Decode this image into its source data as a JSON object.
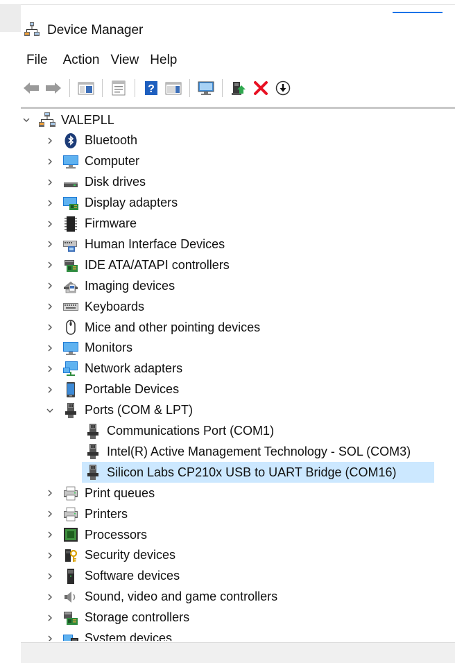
{
  "window": {
    "title": "Device Manager"
  },
  "menu": {
    "items": [
      "File",
      "Action",
      "View",
      "Help"
    ]
  },
  "toolbar": {
    "buttons": [
      {
        "name": "back-icon"
      },
      {
        "name": "forward-icon"
      },
      {
        "name": "show-hide-console-tree-icon"
      },
      {
        "name": "properties-icon"
      },
      {
        "name": "help-icon"
      },
      {
        "name": "action-pane-icon"
      },
      {
        "name": "scan-hardware-icon"
      },
      {
        "name": "update-driver-icon"
      },
      {
        "name": "uninstall-icon"
      },
      {
        "name": "disable-device-icon"
      }
    ]
  },
  "tree": {
    "root": {
      "label": "VALEPLL",
      "expanded": true
    },
    "categories": [
      {
        "label": "Bluetooth",
        "icon": "bluetooth-icon",
        "expanded": false
      },
      {
        "label": "Computer",
        "icon": "computer-icon",
        "expanded": false
      },
      {
        "label": "Disk drives",
        "icon": "disk-drive-icon",
        "expanded": false
      },
      {
        "label": "Display adapters",
        "icon": "display-adapter-icon",
        "expanded": false
      },
      {
        "label": "Firmware",
        "icon": "firmware-icon",
        "expanded": false
      },
      {
        "label": "Human Interface Devices",
        "icon": "hid-icon",
        "expanded": false
      },
      {
        "label": "IDE ATA/ATAPI controllers",
        "icon": "ide-controller-icon",
        "expanded": false
      },
      {
        "label": "Imaging devices",
        "icon": "imaging-icon",
        "expanded": false
      },
      {
        "label": "Keyboards",
        "icon": "keyboard-icon",
        "expanded": false
      },
      {
        "label": "Mice and other pointing devices",
        "icon": "mouse-icon",
        "expanded": false
      },
      {
        "label": "Monitors",
        "icon": "monitor-icon",
        "expanded": false
      },
      {
        "label": "Network adapters",
        "icon": "network-adapter-icon",
        "expanded": false
      },
      {
        "label": "Portable Devices",
        "icon": "portable-device-icon",
        "expanded": false
      },
      {
        "label": "Ports (COM & LPT)",
        "icon": "port-icon",
        "expanded": true
      },
      {
        "label": "Print queues",
        "icon": "print-queue-icon",
        "expanded": false
      },
      {
        "label": "Printers",
        "icon": "printer-icon",
        "expanded": false
      },
      {
        "label": "Processors",
        "icon": "processor-icon",
        "expanded": false
      },
      {
        "label": "Security devices",
        "icon": "security-device-icon",
        "expanded": false
      },
      {
        "label": "Software devices",
        "icon": "software-device-icon",
        "expanded": false
      },
      {
        "label": "Sound, video and game controllers",
        "icon": "sound-icon",
        "expanded": false
      },
      {
        "label": "Storage controllers",
        "icon": "storage-controller-icon",
        "expanded": false
      },
      {
        "label": "System devices",
        "icon": "system-device-icon",
        "expanded": false
      }
    ],
    "ports_children": [
      {
        "label": "Communications Port (COM1)",
        "selected": false
      },
      {
        "label": "Intel(R) Active Management Technology - SOL (COM3)",
        "selected": false
      },
      {
        "label": "Silicon Labs CP210x USB to UART Bridge (COM16)",
        "selected": true
      }
    ]
  },
  "colors": {
    "selection": "#cce8ff",
    "uninstall_red": "#e81123",
    "help_blue": "#1e5fbf"
  }
}
